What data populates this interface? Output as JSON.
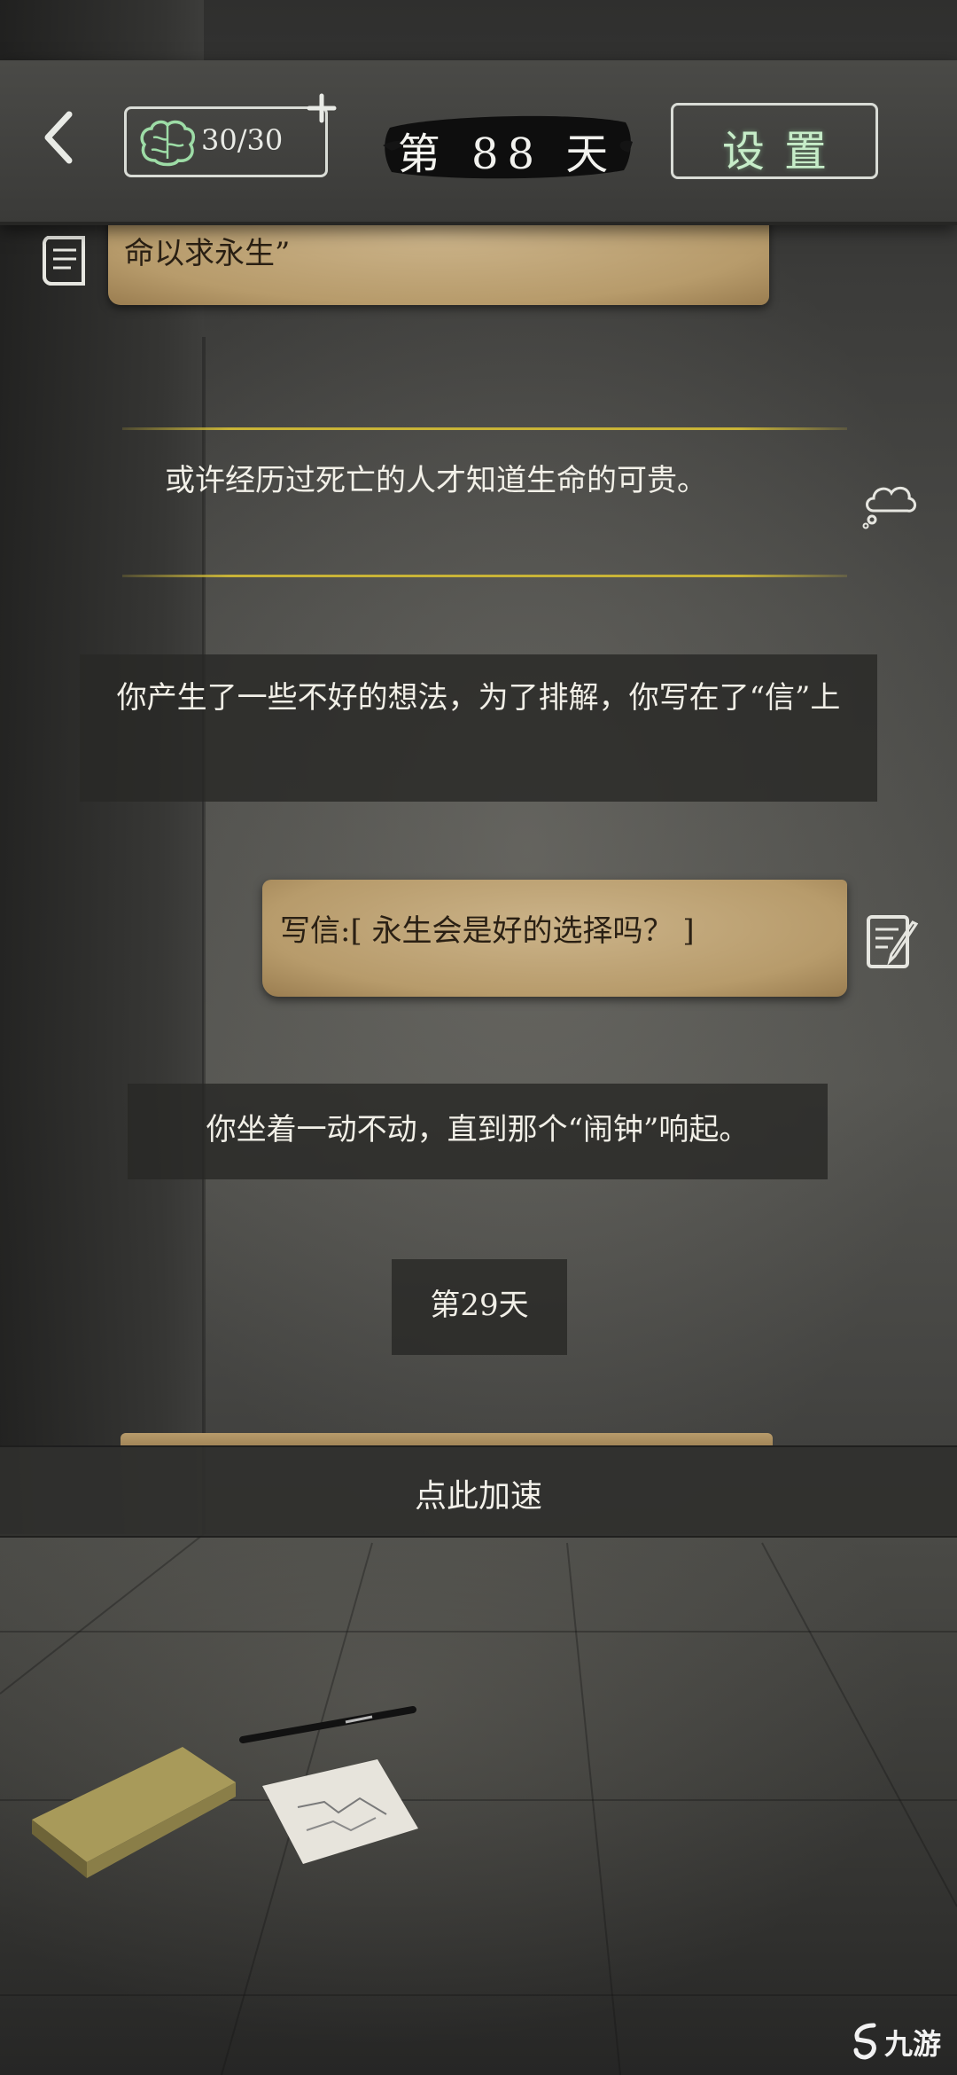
{
  "header": {
    "brain_value": "30/30",
    "day_label": "第 88 天",
    "settings_label": "设置"
  },
  "feed": {
    "letter_received": "来信:“你选择成为了‘监视员’，不断地预支着寿命以求永生”",
    "thought": "或许经历过死亡的人才知道生命的可贵。",
    "bad_idea": "你产生了一些不好的想法，为了排解，你写在了“信”上",
    "write_letter": "写信:[ 永生会是好的选择吗？ ]",
    "sit_still": "你坐着一动不动，直到那个“闹钟”响起。",
    "day_29": "第29天"
  },
  "speed_up": {
    "label": "点此加速"
  },
  "watermark": {
    "text": "九游"
  },
  "icons": {
    "back": "back-arrow-icon",
    "brain": "brain-icon",
    "plus": "plus-icon",
    "letter": "scroll-letter-icon",
    "cloud": "thought-cloud-icon",
    "write": "write-letter-icon"
  },
  "colors": {
    "settings_text": "#c6ecc8",
    "brain_icon": "#9ddca6",
    "gold_line": "#c9b437",
    "paper": "#b79b6b"
  }
}
